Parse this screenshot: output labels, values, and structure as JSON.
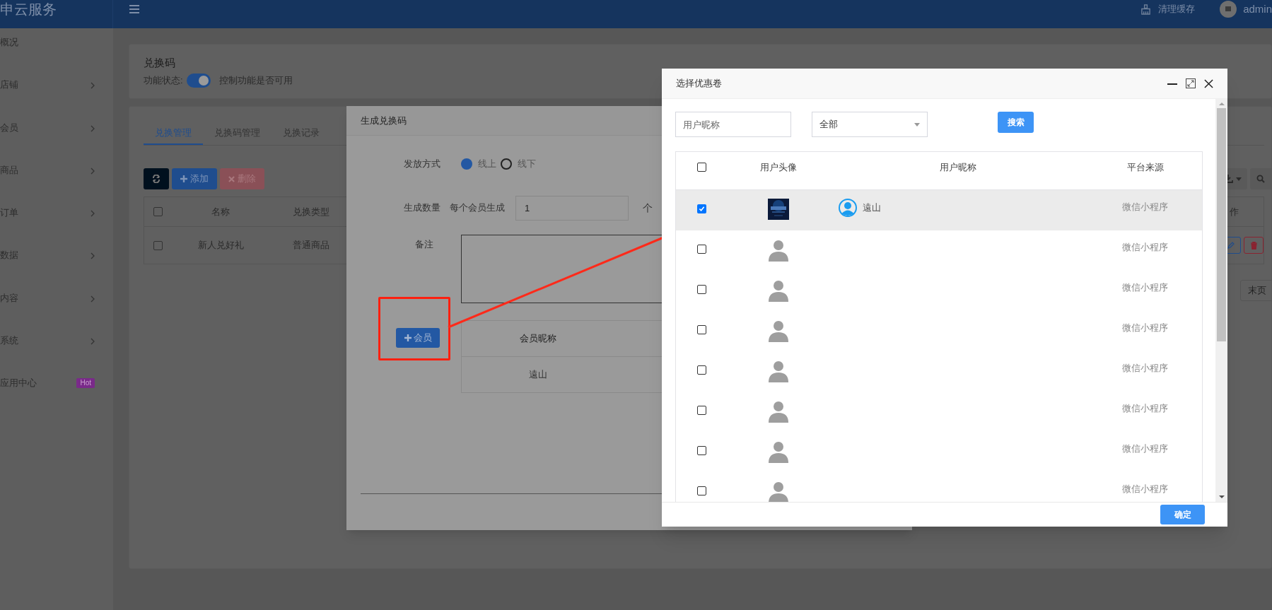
{
  "topbar": {
    "logo": "申云服务",
    "clear_cache": "清理缓存",
    "user": "admin"
  },
  "sidebar": {
    "items": [
      {
        "label": "概况",
        "arrow": false
      },
      {
        "label": "店铺",
        "arrow": true
      },
      {
        "label": "会员",
        "arrow": true
      },
      {
        "label": "商品",
        "arrow": true
      },
      {
        "label": "订单",
        "arrow": true
      },
      {
        "label": "数据",
        "arrow": true
      },
      {
        "label": "内容",
        "arrow": true
      },
      {
        "label": "系统",
        "arrow": true
      },
      {
        "label": "应用中心",
        "arrow": false,
        "badge": "Hot"
      }
    ]
  },
  "header_card": {
    "title": "兑换码",
    "status_label": "功能状态:",
    "status_on": true,
    "status_hint": "控制功能是否可用"
  },
  "tabs": [
    {
      "label": "兑换管理",
      "selected": true
    },
    {
      "label": "兑换码管理",
      "selected": false
    },
    {
      "label": "兑换记录",
      "selected": false
    }
  ],
  "toolbar": {
    "add": "添加",
    "delete": "删除"
  },
  "table": {
    "all_checked": false,
    "columns": [
      "名称",
      "兑换类型"
    ],
    "action_column": "作",
    "rows": [
      {
        "checked": false,
        "cells": [
          "新人兑好礼",
          "普通商品"
        ]
      }
    ]
  },
  "pagination": {
    "last": "末页"
  },
  "generate_dialog": {
    "title": "生成兑换码",
    "issue_label": "发放方式",
    "issue_options": [
      {
        "label": "线上",
        "selected": true
      },
      {
        "label": "线下",
        "selected": false
      }
    ],
    "count_label": "生成数量",
    "count_prefix": "每个会员生成",
    "count_value": "1",
    "count_unit": "个",
    "note_label": "备注",
    "member_button": "会员",
    "member_table": {
      "column": "会员昵称",
      "rows": [
        "遠山"
      ]
    }
  },
  "select_dialog": {
    "title": "选择优惠卷",
    "search_placeholder": "用户昵称",
    "filter_value": "全部",
    "search_button": "搜索",
    "all_checked": false,
    "columns": [
      "用户头像",
      "用户昵称",
      "平台来源"
    ],
    "rows": [
      {
        "checked": true,
        "kind": "picture",
        "nickname": "遠山",
        "source": "微信小程序"
      },
      {
        "checked": false,
        "kind": "default",
        "source": "微信小程序"
      },
      {
        "checked": false,
        "kind": "default",
        "source": "微信小程序"
      },
      {
        "checked": false,
        "kind": "default",
        "source": "微信小程序"
      },
      {
        "checked": false,
        "kind": "default",
        "source": "微信小程序"
      },
      {
        "checked": false,
        "kind": "default",
        "source": "微信小程序"
      },
      {
        "checked": false,
        "kind": "default",
        "source": "微信小程序"
      },
      {
        "checked": false,
        "kind": "default",
        "source": "微信小程序"
      }
    ],
    "confirm": "确定"
  }
}
